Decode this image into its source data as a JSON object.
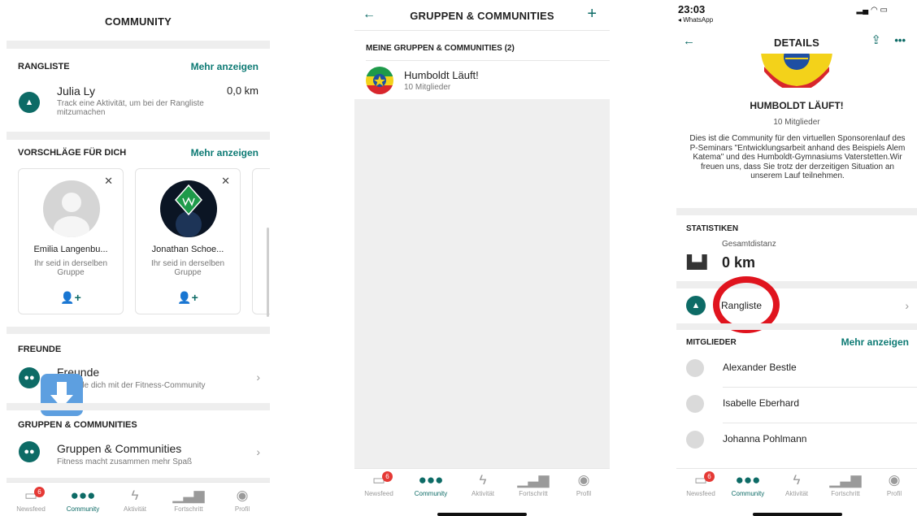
{
  "screen1": {
    "title": "COMMUNITY",
    "rangliste": {
      "title": "RANGLISTE",
      "more": "Mehr anzeigen",
      "user_name": "Julia Ly",
      "distance": "0,0 km",
      "hint": "Track eine Aktivität, um bei der Rangliste mitzumachen"
    },
    "suggestions": {
      "title": "VORSCHLÄGE FÜR DICH",
      "more": "Mehr anzeigen",
      "cards": [
        {
          "name": "Emilia Langenbu...",
          "subtitle": "Ihr seid in derselben Gruppe"
        },
        {
          "name": "Jonathan Schoe...",
          "subtitle": "Ihr seid in derselben Gruppe"
        }
      ]
    },
    "friends": {
      "title": "FREUNDE",
      "item_title": "Freunde",
      "item_subtitle": "de dich mit der Fitness-Community"
    },
    "groups": {
      "title": "GRUPPEN & COMMUNITIES",
      "item_title": "Gruppen & Communities",
      "item_subtitle": "Fitness macht zusammen mehr Spaß"
    }
  },
  "screen2": {
    "title": "GRUPPEN & COMMUNITIES",
    "section": "MEINE GRUPPEN & COMMUNITIES (2)",
    "group_name": "Humboldt Läuft!",
    "group_members": "10 Mitglieder"
  },
  "screen3": {
    "status_time": "23:03",
    "status_back_app": "◂ WhatsApp",
    "title": "DETAILS",
    "group_name": "HUMBOLDT LÄUFT!",
    "members_count": "10 Mitglieder",
    "description": "Dies ist die Community für den virtuellen Sponsorenlauf des P-Seminars \"Entwicklungsarbeit anhand des Beispiels Alem Katema\" und des Humboldt-Gymnasiums Vaterstetten.Wir freuen uns, dass Sie trotz der derzeitigen Situation an unserem Lauf teilnehmen.",
    "stats_title": "STATISTIKEN",
    "total_label": "Gesamtdistanz",
    "total_value": "0 km",
    "leaderboard_label": "Rangliste",
    "members_title": "MITGLIEDER",
    "members_more": "Mehr anzeigen",
    "members": [
      "Alexander Bestle",
      "Isabelle Eberhard",
      "Johanna Pohlmann"
    ]
  },
  "tabs": [
    {
      "label": "Newsfeed",
      "icon": "newsfeed-icon"
    },
    {
      "label": "Community",
      "icon": "community-icon"
    },
    {
      "label": "Aktivität",
      "icon": "activity-icon"
    },
    {
      "label": "Fortschritt",
      "icon": "progress-icon"
    },
    {
      "label": "Profil",
      "icon": "profile-icon"
    }
  ],
  "newsfeed_badge": "6",
  "colors": {
    "accent": "#0d6b66",
    "highlight_ring": "#e0141e",
    "badge": "#e53935"
  }
}
